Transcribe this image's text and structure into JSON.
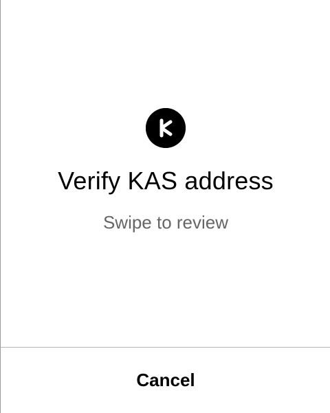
{
  "screen": {
    "title": "Verify KAS address",
    "subtitle": "Swipe to review",
    "logo_icon": "kaspa-logo-icon"
  },
  "footer": {
    "cancel_label": "Cancel"
  },
  "colors": {
    "background": "#ffffff",
    "text": "#000000",
    "subtitle": "#666666",
    "divider": "#b5b5b5",
    "logo": "#000000"
  }
}
